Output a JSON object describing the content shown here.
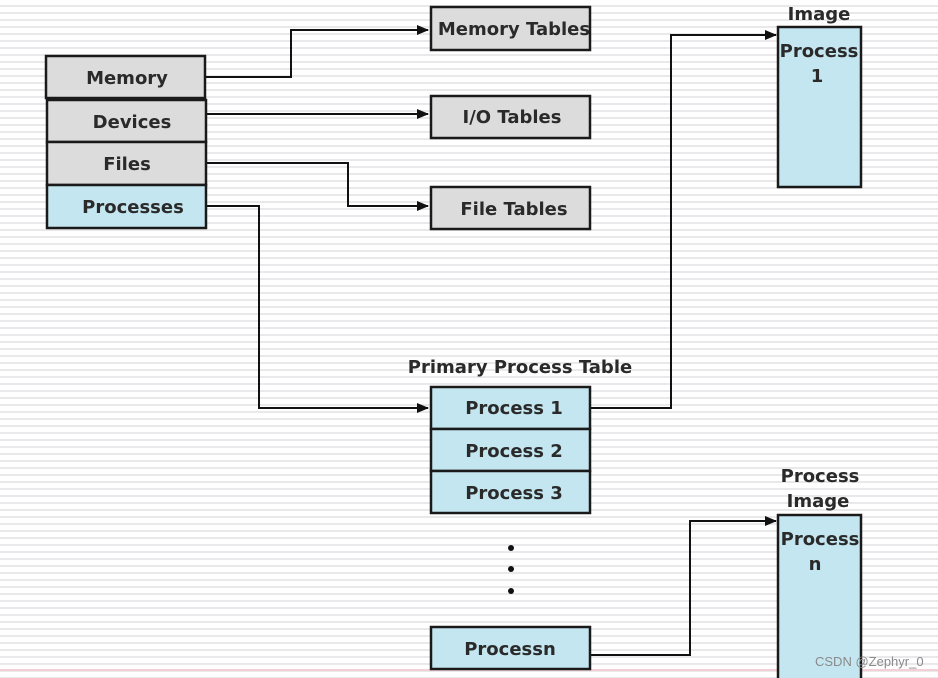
{
  "colors": {
    "gray_box": "#dcdcdc",
    "blue_box": "#c4e6f0",
    "stroke": "#1a1a1a"
  },
  "resource_table": [
    "Memory",
    "Devices",
    "Files",
    "Processes"
  ],
  "tables": {
    "memory": "Memory Tables",
    "io": "I/O Tables",
    "file": "File Tables"
  },
  "primary_table": {
    "title": "Primary Process Table",
    "rows": [
      "Process 1",
      "Process 2",
      "Process 3"
    ],
    "last": "Processn"
  },
  "image1": {
    "label": "Image",
    "line1": "Process",
    "line2": "1"
  },
  "imagen": {
    "label1": "Process",
    "label2": "Image",
    "line1": "Process",
    "line2": "n"
  },
  "watermark": "CSDN @Zephyr_0"
}
